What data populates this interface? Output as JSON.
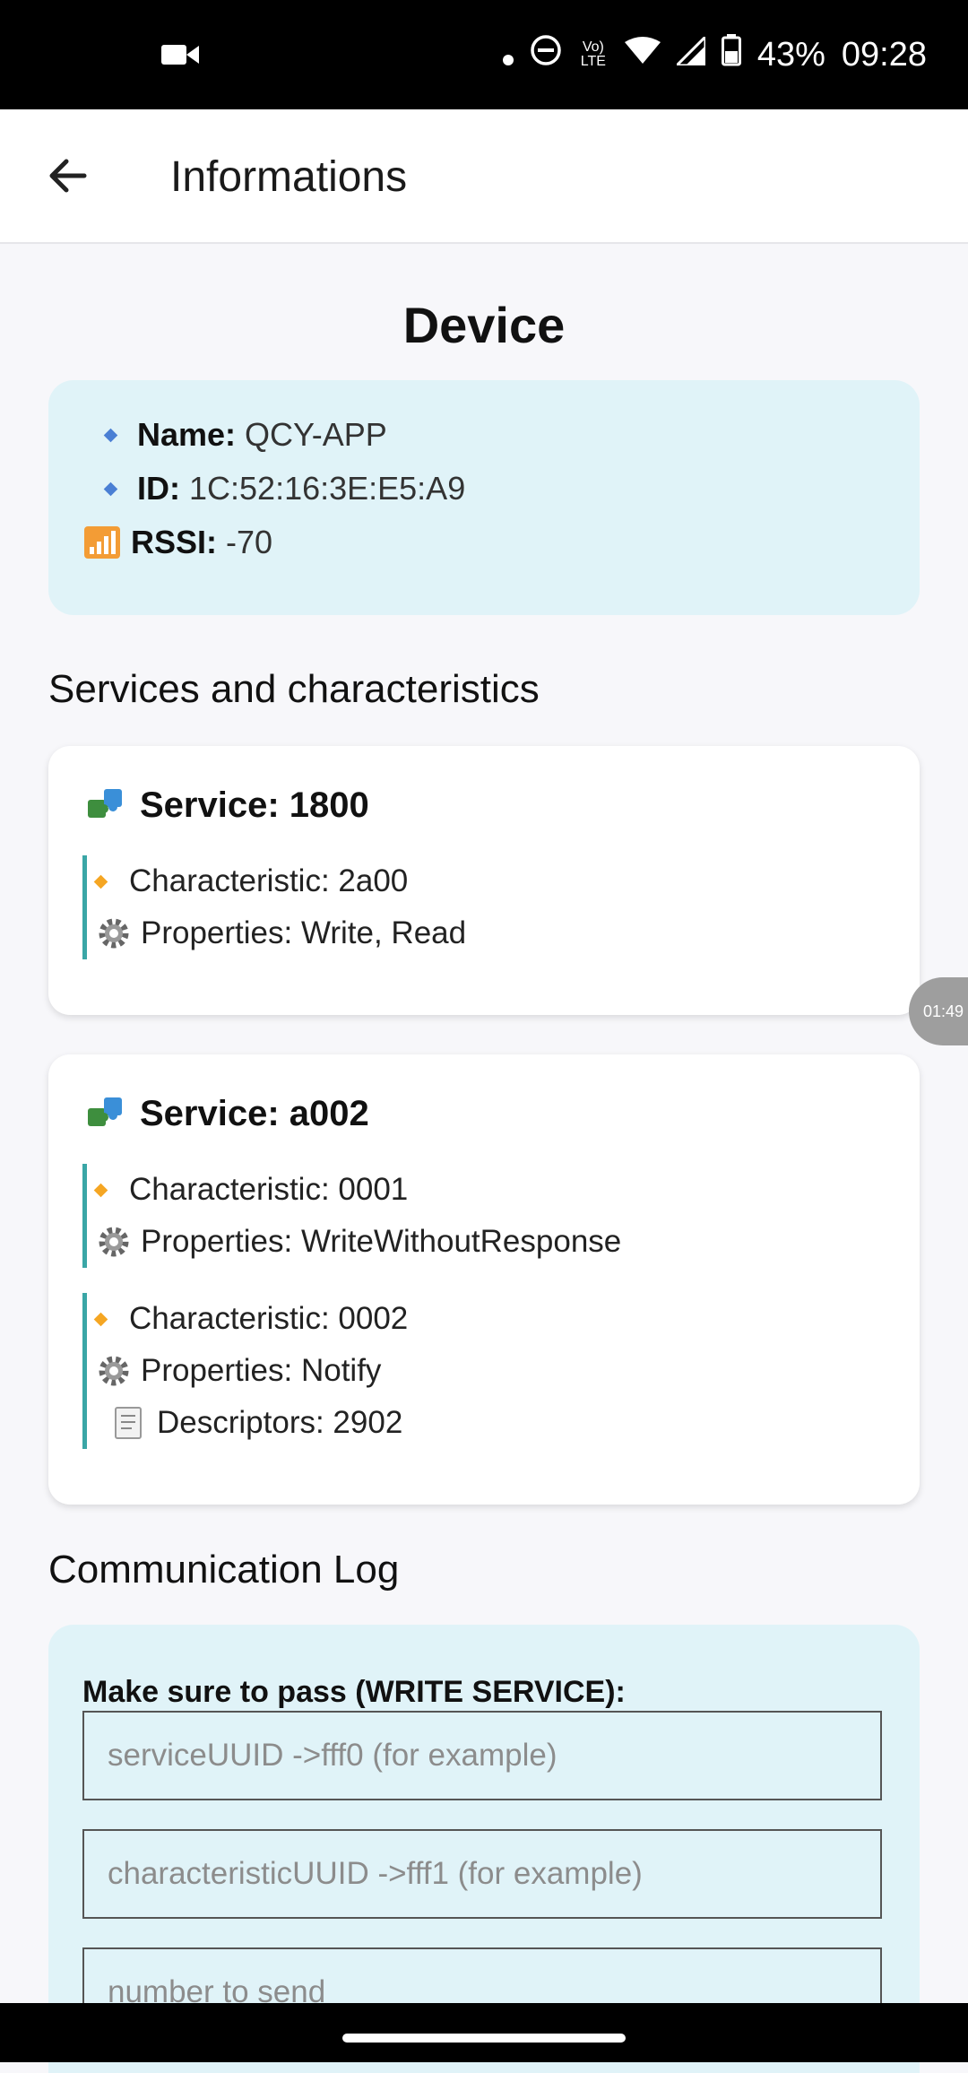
{
  "status_bar": {
    "battery": "43%",
    "time": "09:28",
    "network": "Vo) LTE"
  },
  "app_bar": {
    "title": "Informations"
  },
  "device": {
    "heading": "Device",
    "name_label": "Name:",
    "name_value": "QCY-APP",
    "id_label": "ID:",
    "id_value": "1C:52:16:3E:E5:A9",
    "rssi_label": "RSSI:",
    "rssi_value": "-70"
  },
  "services_heading": "Services and characteristics",
  "services": [
    {
      "title": "Service: 1800",
      "characteristics": [
        {
          "characteristic": "Characteristic: 2a00",
          "properties": "Properties: Write, Read"
        }
      ]
    },
    {
      "title": "Service: a002",
      "characteristics": [
        {
          "characteristic": "Characteristic: 0001",
          "properties": "Properties: WriteWithoutResponse"
        },
        {
          "characteristic": "Characteristic: 0002",
          "properties": "Properties: Notify",
          "descriptors": "Descriptors: 2902"
        }
      ]
    }
  ],
  "log": {
    "heading": "Communication Log",
    "label": "Make sure to pass (WRITE SERVICE):",
    "service_placeholder": "serviceUUID ->fff0 (for example)",
    "characteristic_placeholder": "characteristicUUID ->fff1 (for example)",
    "number_placeholder": "number to send"
  },
  "floating_timer": "01:49"
}
